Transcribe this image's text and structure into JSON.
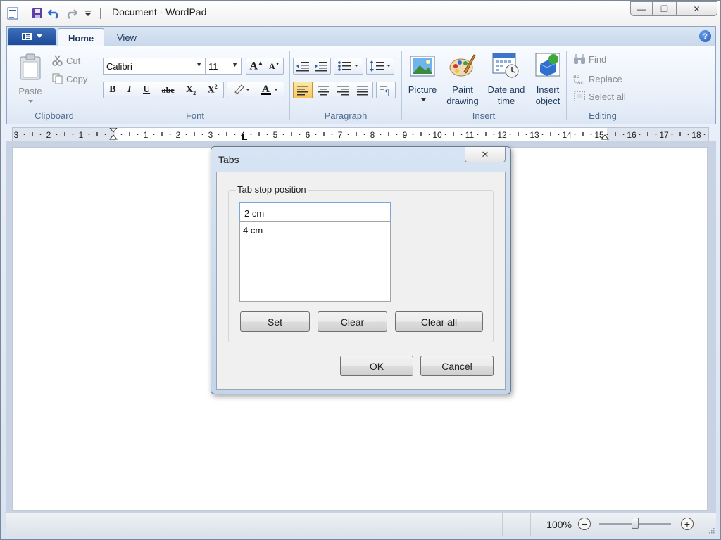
{
  "window": {
    "title": "Document - WordPad",
    "controls": {
      "minimize": "—",
      "restore": "❐",
      "close": "✕"
    }
  },
  "ribbon": {
    "tabs": [
      {
        "label": "Home",
        "active": true
      },
      {
        "label": "View",
        "active": false
      }
    ],
    "help_label": "?",
    "clipboard": {
      "paste": "Paste",
      "cut": "Cut",
      "copy": "Copy",
      "group": "Clipboard"
    },
    "font": {
      "family": "Calibri",
      "size": "11",
      "group": "Font"
    },
    "paragraph": {
      "group": "Paragraph"
    },
    "insert": {
      "picture": "Picture",
      "paint_drawing_1": "Paint",
      "paint_drawing_2": "drawing",
      "date_time_1": "Date and",
      "date_time_2": "time",
      "insert_object_1": "Insert",
      "insert_object_2": "object",
      "group": "Insert"
    },
    "editing": {
      "find": "Find",
      "replace": "Replace",
      "select_all": "Select all",
      "group": "Editing"
    }
  },
  "ruler": {
    "labels": [
      "3",
      "2",
      "1",
      "1",
      "2",
      "3",
      "4",
      "5",
      "6",
      "7",
      "8",
      "9",
      "10",
      "11",
      "12",
      "13",
      "14",
      "15",
      "16",
      "17",
      "18"
    ]
  },
  "dialog": {
    "title": "Tabs",
    "close": "✕",
    "group_label": "Tab stop position",
    "input_value": "2 cm",
    "list_items": [
      "4 cm"
    ],
    "buttons": {
      "set": "Set",
      "clear": "Clear",
      "clear_all": "Clear all",
      "ok": "OK",
      "cancel": "Cancel"
    }
  },
  "status": {
    "zoom": "100%",
    "zoom_out": "−",
    "zoom_in": "+",
    "zoom_fraction": 0.5
  }
}
